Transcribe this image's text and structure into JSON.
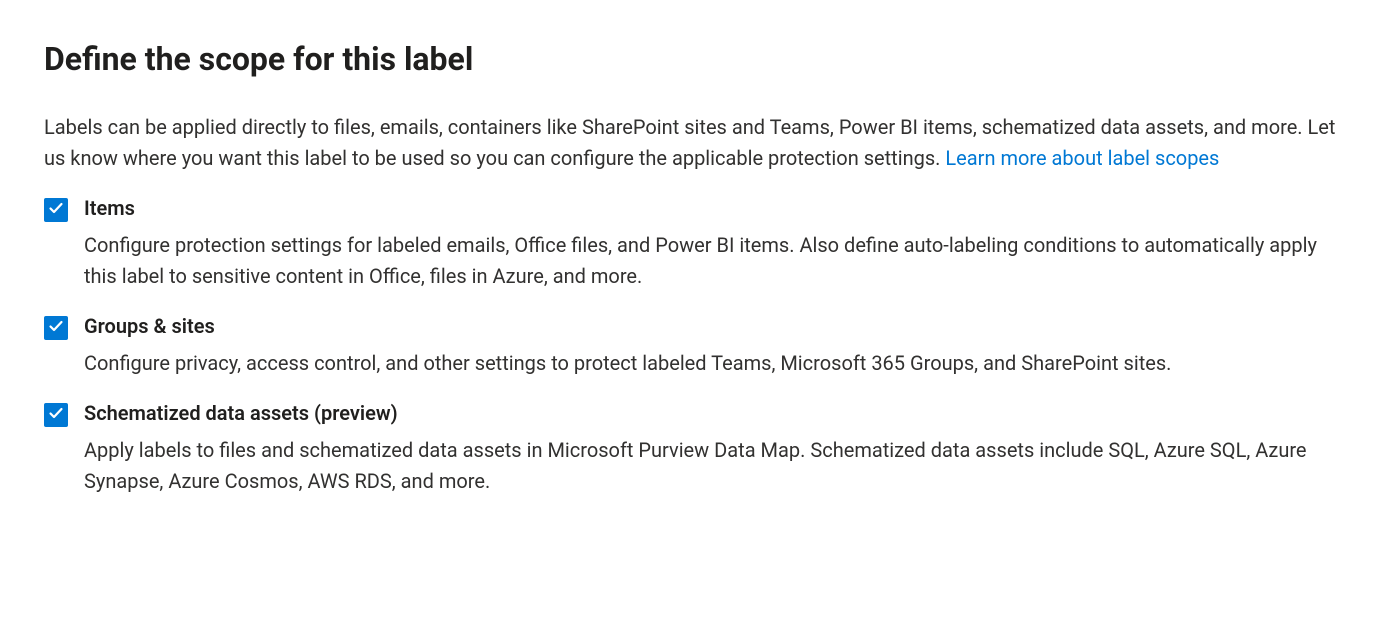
{
  "header": {
    "title": "Define the scope for this label"
  },
  "intro": {
    "text": "Labels can be applied directly to files, emails, containers like SharePoint sites and Teams, Power BI items, schematized data assets, and more. Let us know where you want this label to be used so you can configure the applicable protection settings. ",
    "link_text": "Learn more about label scopes"
  },
  "options": [
    {
      "checked": true,
      "title": "Items",
      "description": "Configure protection settings for labeled emails, Office files, and Power BI items. Also define auto-labeling conditions to automatically apply this label to sensitive content in Office, files in Azure, and more."
    },
    {
      "checked": true,
      "title": "Groups & sites",
      "description": "Configure privacy, access control, and other settings to protect labeled Teams, Microsoft 365 Groups, and SharePoint sites."
    },
    {
      "checked": true,
      "title": "Schematized data assets (preview)",
      "description": "Apply labels to files and schematized data assets in Microsoft Purview Data Map. Schematized data assets include SQL, Azure SQL, Azure Synapse, Azure Cosmos, AWS RDS, and more."
    }
  ]
}
